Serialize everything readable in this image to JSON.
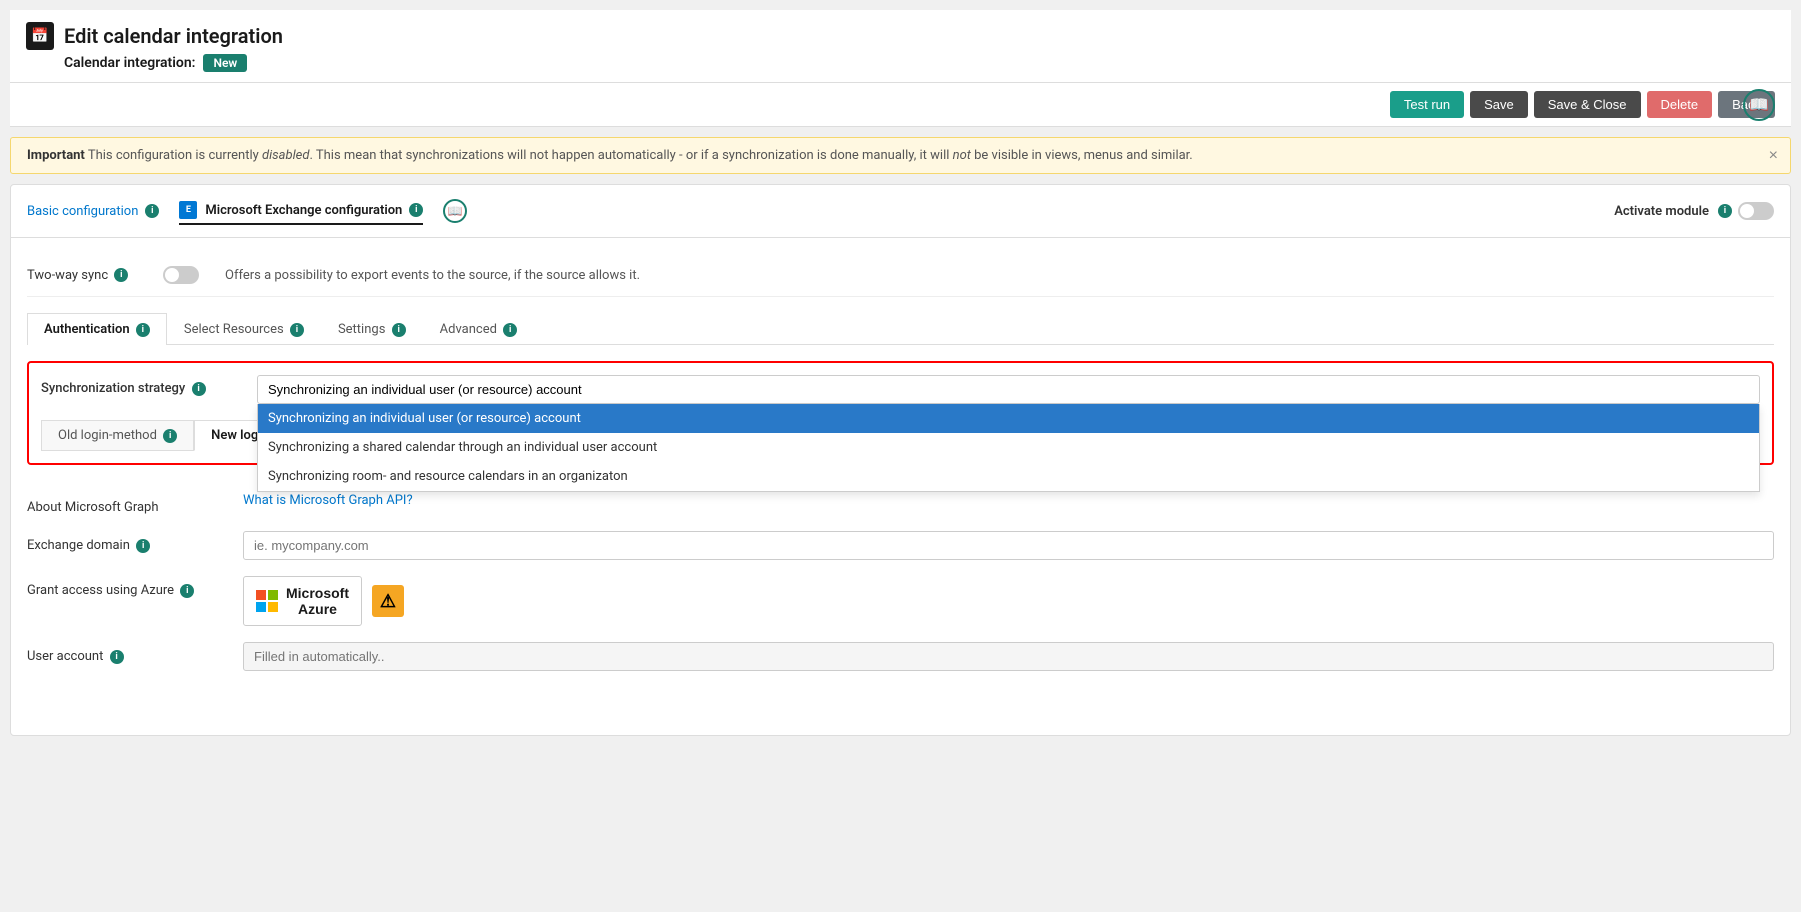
{
  "page": {
    "icon": "📅",
    "title": "Edit calendar integration",
    "subtitle_label": "Calendar integration:",
    "badge": "New"
  },
  "toolbar": {
    "test_run": "Test run",
    "save": "Save",
    "save_close": "Save & Close",
    "delete": "Delete",
    "back": "Back"
  },
  "alert": {
    "text_bold": "Important",
    "text_italic_1": "disabled",
    "text_italic_2": "not",
    "text_main": " This configuration is currently  . This mean that synchronizations will not happen automatically - or if a synchronization is done manually, it will  be visible in views, menus and similar."
  },
  "tabs": {
    "basic_config": "Basic configuration",
    "ms_exchange": "Microsoft Exchange configuration",
    "activate_module": "Activate module"
  },
  "two_way_sync": {
    "label": "Two-way sync",
    "description": "Offers a possibility to export events to the source, if the source allows it."
  },
  "inner_tabs": {
    "authentication": "Authentication",
    "select_resources": "Select Resources",
    "settings": "Settings",
    "advanced": "Advanced"
  },
  "sync_strategy": {
    "label": "Synchronization strategy",
    "selected": "Synchronizing an individual user (or resource) account",
    "options": [
      "Synchronizing an individual user (or resource) account",
      "Synchronizing a shared calendar through an individual user account",
      "Synchronizing room- and resource calendars in an organizaton"
    ]
  },
  "login_tabs": {
    "old": "Old login-method",
    "new": "New login-method"
  },
  "about_ms_graph": {
    "label": "About Microsoft Graph",
    "link": "What is Microsoft Graph API?"
  },
  "exchange_domain": {
    "label": "Exchange domain",
    "placeholder": "ie. mycompany.com"
  },
  "grant_access": {
    "label": "Grant access using Azure",
    "btn_text": "Microsoft\nAzure"
  },
  "user_account": {
    "label": "User account",
    "placeholder": "Filled in automatically.."
  }
}
